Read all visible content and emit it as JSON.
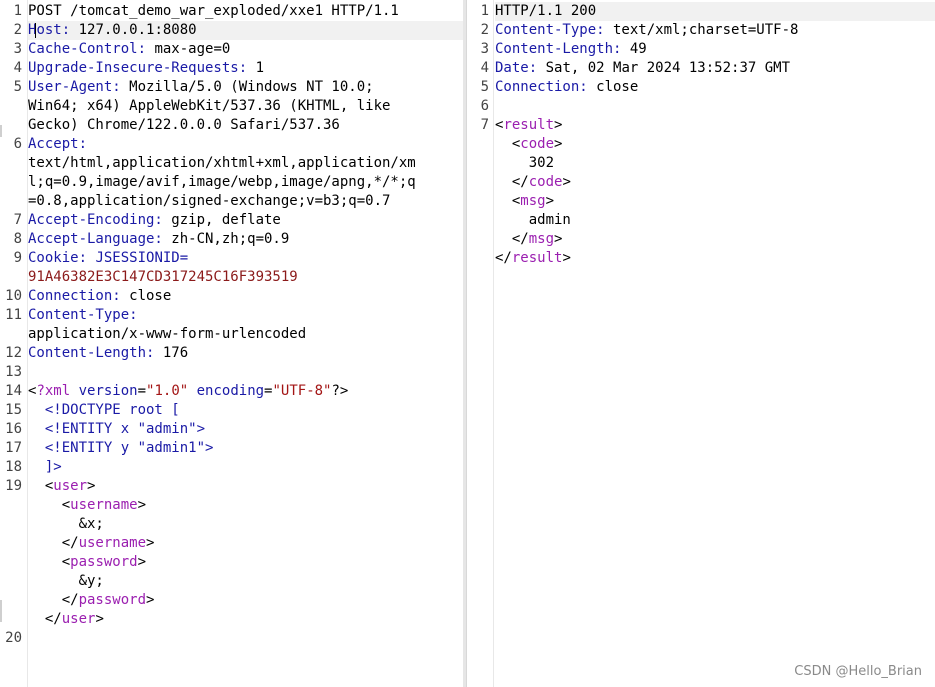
{
  "request": {
    "lines": [
      {
        "num": "1",
        "rows": [
          [
            {
              "t": "POST /tomcat_demo_war_exploded/xxe1 HTTP/1.1",
              "c": ""
            }
          ]
        ]
      },
      {
        "num": "2",
        "rows": [
          [
            {
              "t": "H",
              "c": "k"
            },
            {
              "caret": true
            },
            {
              "t": "ost:",
              "c": "k"
            },
            {
              "t": " 127.0.0.1:8080",
              "c": ""
            }
          ]
        ],
        "hl": true
      },
      {
        "num": "3",
        "rows": [
          [
            {
              "t": "Cache-Control:",
              "c": "k"
            },
            {
              "t": " max-age=0",
              "c": ""
            }
          ]
        ]
      },
      {
        "num": "4",
        "rows": [
          [
            {
              "t": "Upgrade-Insecure-Requests:",
              "c": "k"
            },
            {
              "t": " 1",
              "c": ""
            }
          ]
        ]
      },
      {
        "num": "5",
        "rows": [
          [
            {
              "t": "User-Agent:",
              "c": "k"
            },
            {
              "t": " Mozilla/5.0 (Windows NT 10.0;",
              "c": ""
            }
          ],
          [
            {
              "t": "Win64; x64) AppleWebKit/537.36 (KHTML, like",
              "c": ""
            }
          ],
          [
            {
              "t": "Gecko) Chrome/122.0.0.0 Safari/537.36",
              "c": ""
            }
          ]
        ]
      },
      {
        "num": "6",
        "rows": [
          [
            {
              "t": "Accept:",
              "c": "k"
            }
          ],
          [
            {
              "t": "text/html,application/xhtml+xml,application/xm",
              "c": ""
            }
          ],
          [
            {
              "t": "l;q=0.9,image/avif,image/webp,image/apng,*/*;q",
              "c": ""
            }
          ],
          [
            {
              "t": "=0.8,application/signed-exchange;v=b3;q=0.7",
              "c": ""
            }
          ]
        ]
      },
      {
        "num": "7",
        "rows": [
          [
            {
              "t": "Accept-Encoding:",
              "c": "k"
            },
            {
              "t": " gzip, deflate",
              "c": ""
            }
          ]
        ]
      },
      {
        "num": "8",
        "rows": [
          [
            {
              "t": "Accept-Language:",
              "c": "k"
            },
            {
              "t": " zh-CN,zh;q=0.9",
              "c": ""
            }
          ]
        ]
      },
      {
        "num": "9",
        "rows": [
          [
            {
              "t": "Cookie:",
              "c": "k"
            },
            {
              "t": " JSESSIONID=",
              "c": "k"
            }
          ],
          [
            {
              "t": "91A46382E3C147CD317245C16F393519",
              "c": "sid"
            }
          ]
        ]
      },
      {
        "num": "10",
        "rows": [
          [
            {
              "t": "Connection:",
              "c": "k"
            },
            {
              "t": " close",
              "c": ""
            }
          ]
        ]
      },
      {
        "num": "11",
        "rows": [
          [
            {
              "t": "Content-Type:",
              "c": "k"
            }
          ],
          [
            {
              "t": "application/x-www-form-urlencoded",
              "c": ""
            }
          ]
        ]
      },
      {
        "num": "12",
        "rows": [
          [
            {
              "t": "Content-Length:",
              "c": "k"
            },
            {
              "t": " 176",
              "c": ""
            }
          ]
        ]
      },
      {
        "num": "13",
        "rows": [
          [
            {
              "t": "",
              "c": ""
            }
          ]
        ]
      },
      {
        "num": "14",
        "rows": [
          [
            {
              "t": "<",
              "c": ""
            },
            {
              "t": "?xml",
              "c": "tag"
            },
            {
              "t": " version",
              "c": "attr"
            },
            {
              "t": "=",
              "c": ""
            },
            {
              "t": "\"1.0\"",
              "c": "str"
            },
            {
              "t": " encoding",
              "c": "attr"
            },
            {
              "t": "=",
              "c": ""
            },
            {
              "t": "\"UTF-8\"",
              "c": "str"
            },
            {
              "t": "?>",
              "c": ""
            }
          ]
        ]
      },
      {
        "num": "15",
        "rows": [
          [
            {
              "t": "  <!DOCTYPE root [",
              "c": "k"
            }
          ]
        ]
      },
      {
        "num": "16",
        "rows": [
          [
            {
              "t": "  <!ENTITY x \"admin\">",
              "c": "k"
            }
          ]
        ]
      },
      {
        "num": "17",
        "rows": [
          [
            {
              "t": "  <!ENTITY y \"admin1\">",
              "c": "k"
            }
          ]
        ]
      },
      {
        "num": "18",
        "rows": [
          [
            {
              "t": "  ]>",
              "c": "k"
            }
          ]
        ]
      },
      {
        "num": "19",
        "rows": [
          [
            {
              "t": "  <",
              "c": ""
            },
            {
              "t": "user",
              "c": "tag"
            },
            {
              "t": ">",
              "c": ""
            }
          ],
          [
            {
              "t": "    <",
              "c": ""
            },
            {
              "t": "username",
              "c": "tag"
            },
            {
              "t": ">",
              "c": ""
            }
          ],
          [
            {
              "t": "      &x;",
              "c": ""
            }
          ],
          [
            {
              "t": "    </",
              "c": ""
            },
            {
              "t": "username",
              "c": "tag"
            },
            {
              "t": ">",
              "c": ""
            }
          ],
          [
            {
              "t": "    <",
              "c": ""
            },
            {
              "t": "password",
              "c": "tag"
            },
            {
              "t": ">",
              "c": ""
            }
          ],
          [
            {
              "t": "      &y;",
              "c": ""
            }
          ],
          [
            {
              "t": "    </",
              "c": ""
            },
            {
              "t": "password",
              "c": "tag"
            },
            {
              "t": ">",
              "c": ""
            }
          ],
          [
            {
              "t": "  </",
              "c": ""
            },
            {
              "t": "user",
              "c": "tag"
            },
            {
              "t": ">",
              "c": ""
            }
          ]
        ]
      },
      {
        "num": "20",
        "rows": [
          [
            {
              "t": "",
              "c": ""
            }
          ]
        ],
        "gapBefore": true
      }
    ]
  },
  "response": {
    "lines": [
      {
        "num": "1",
        "rows": [
          [
            {
              "t": "HTTP/1.1 200",
              "c": ""
            }
          ]
        ],
        "hl": true
      },
      {
        "num": "2",
        "rows": [
          [
            {
              "t": "Content-Type:",
              "c": "k"
            },
            {
              "t": " text/xml;charset=UTF-8",
              "c": ""
            }
          ]
        ]
      },
      {
        "num": "3",
        "rows": [
          [
            {
              "t": "Content-Length:",
              "c": "k"
            },
            {
              "t": " 49",
              "c": ""
            }
          ]
        ]
      },
      {
        "num": "4",
        "rows": [
          [
            {
              "t": "Date:",
              "c": "k"
            },
            {
              "t": " Sat, 02 Mar 2024 13:52:37 GMT",
              "c": ""
            }
          ]
        ]
      },
      {
        "num": "5",
        "rows": [
          [
            {
              "t": "Connection:",
              "c": "k"
            },
            {
              "t": " close",
              "c": ""
            }
          ]
        ]
      },
      {
        "num": "6",
        "rows": [
          [
            {
              "t": "",
              "c": ""
            }
          ]
        ]
      },
      {
        "num": "7",
        "rows": [
          [
            {
              "t": "<",
              "c": ""
            },
            {
              "t": "result",
              "c": "tag"
            },
            {
              "t": ">",
              "c": ""
            }
          ],
          [
            {
              "t": "  <",
              "c": ""
            },
            {
              "t": "code",
              "c": "tag"
            },
            {
              "t": ">",
              "c": ""
            }
          ],
          [
            {
              "t": "    302",
              "c": ""
            }
          ],
          [
            {
              "t": "  </",
              "c": ""
            },
            {
              "t": "code",
              "c": "tag"
            },
            {
              "t": ">",
              "c": ""
            }
          ],
          [
            {
              "t": "  <",
              "c": ""
            },
            {
              "t": "msg",
              "c": "tag"
            },
            {
              "t": ">",
              "c": ""
            }
          ],
          [
            {
              "t": "    admin",
              "c": ""
            }
          ],
          [
            {
              "t": "  </",
              "c": ""
            },
            {
              "t": "msg",
              "c": "tag"
            },
            {
              "t": ">",
              "c": ""
            }
          ],
          [
            {
              "t": "</",
              "c": ""
            },
            {
              "t": "result",
              "c": "tag"
            },
            {
              "t": ">",
              "c": ""
            }
          ]
        ]
      }
    ]
  },
  "watermark": "CSDN @Hello_Brian",
  "colors": {
    "header_key": "#1a1aa6",
    "xml_tag": "#9b1fb0",
    "string": "#a31515",
    "session_id": "#8b1a1a"
  }
}
